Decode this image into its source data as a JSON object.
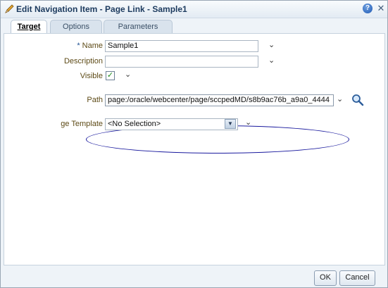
{
  "dialog": {
    "title": "Edit Navigation Item - Page Link - Sample1"
  },
  "tabs": [
    {
      "label": "Target",
      "active": true
    },
    {
      "label": "Options",
      "active": false
    },
    {
      "label": "Parameters",
      "active": false
    }
  ],
  "form": {
    "name": {
      "label": "Name",
      "required_mark": "*",
      "value": "Sample1"
    },
    "description": {
      "label": "Description",
      "value": ""
    },
    "visible": {
      "label": "Visible",
      "checked": true
    },
    "path": {
      "label": "Path",
      "value": "page:/oracle/webcenter/page/sccpedMD/s8b9ac76b_a9a0_4444"
    },
    "page_template": {
      "label": "ge Template",
      "value": "<No Selection>"
    }
  },
  "buttons": {
    "ok": "OK",
    "cancel": "Cancel"
  },
  "icons": {
    "title": "pencil-icon",
    "help": "help-icon",
    "close": "close-icon",
    "search": "search-icon",
    "chevron": "chevron-down-icon",
    "check": "checkmark-icon"
  },
  "colors": {
    "annotation_ellipse": "#1a1a9e",
    "label_text": "#5d4a16"
  }
}
